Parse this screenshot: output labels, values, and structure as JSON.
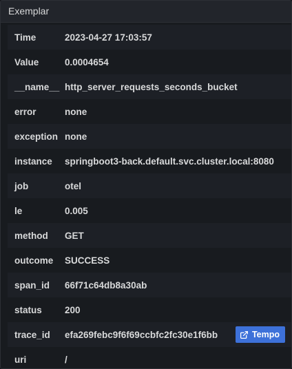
{
  "panel": {
    "title": "Exemplar"
  },
  "rows": [
    {
      "key": "Time",
      "value": "2023-04-27 17:03:57"
    },
    {
      "key": "Value",
      "value": "0.0004654"
    },
    {
      "key": "__name__",
      "value": "http_server_requests_seconds_bucket"
    },
    {
      "key": "error",
      "value": "none"
    },
    {
      "key": "exception",
      "value": "none"
    },
    {
      "key": "instance",
      "value": "springboot3-back.default.svc.cluster.local:8080"
    },
    {
      "key": "job",
      "value": "otel"
    },
    {
      "key": "le",
      "value": "0.005"
    },
    {
      "key": "method",
      "value": "GET"
    },
    {
      "key": "outcome",
      "value": "SUCCESS"
    },
    {
      "key": "span_id",
      "value": "66f71c64db8a30ab"
    },
    {
      "key": "status",
      "value": "200"
    },
    {
      "key": "trace_id",
      "value": "efa269febc9f6f69ccbfc2fc30e1f6bb",
      "link": {
        "label": "Tempo",
        "icon": "external-link-icon"
      }
    },
    {
      "key": "uri",
      "value": "/"
    }
  ],
  "colors": {
    "link_button": "#3d71d9",
    "row_alt": "#1d2026",
    "background": "#181b1f"
  }
}
